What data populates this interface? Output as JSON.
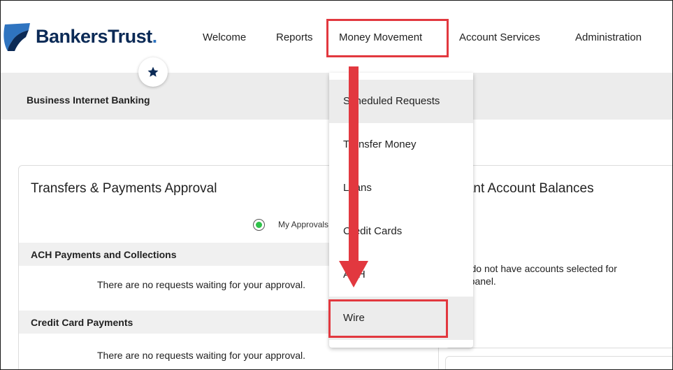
{
  "brand": {
    "name": "BankersTrust",
    "suffix": ".",
    "colors": {
      "navy": "#0b2a56",
      "blue": "#2f74c0",
      "highlight": "#e2383f",
      "radio": "#2fc24a"
    }
  },
  "nav": {
    "items": [
      {
        "label": "Welcome"
      },
      {
        "label": "Reports"
      },
      {
        "label": "Money Movement"
      },
      {
        "label": "Account Services"
      },
      {
        "label": "Administration"
      }
    ]
  },
  "favorites_icon": "star-icon",
  "subheader": {
    "title": "Business Internet Banking"
  },
  "dropdown": {
    "items": [
      {
        "label": "Scheduled Requests"
      },
      {
        "label": "Transfer Money"
      },
      {
        "label": "Loans"
      },
      {
        "label": "Credit Cards"
      },
      {
        "label": "ACH"
      },
      {
        "label": "Wire"
      }
    ]
  },
  "approval_panel": {
    "title": "Transfers & Payments Approval",
    "radio_label": "My Approvals",
    "sections": [
      {
        "label": "ACH Payments and Collections",
        "message": "There are no requests waiting for your approval."
      },
      {
        "label": "Credit Card Payments",
        "message": "There are no requests waiting for your approval."
      }
    ]
  },
  "balances_panel": {
    "title": "Important Account Balances",
    "message_line1": "You do not have accounts selected for",
    "message_line2": "this panel."
  }
}
